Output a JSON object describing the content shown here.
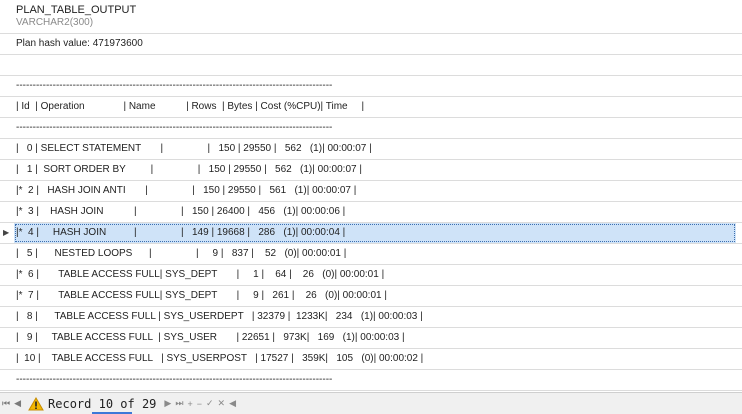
{
  "column": {
    "name": "PLAN_TABLE_OUTPUT",
    "type": "VARCHAR2(300)"
  },
  "rows": [
    "Plan hash value: 471973600",
    "",
    "-----------------------------------------------------------------------------------------------",
    "| Id  | Operation              | Name           | Rows  | Bytes | Cost (%CPU)| Time     |",
    "-----------------------------------------------------------------------------------------------",
    "|   0 | SELECT STATEMENT       |                |   150 | 29550 |   562   (1)| 00:00:07 |",
    "|   1 |  SORT ORDER BY         |                |   150 | 29550 |   562   (1)| 00:00:07 |",
    "|*  2 |   HASH JOIN ANTI       |                |   150 | 29550 |   561   (1)| 00:00:07 |",
    "|*  3 |    HASH JOIN           |                |   150 | 26400 |   456   (1)| 00:00:06 |",
    "|*  4 |     HASH JOIN          |                |   149 | 19668 |   286   (1)| 00:00:04 |",
    "|   5 |      NESTED LOOPS      |                |     9 |   837 |    52   (0)| 00:00:01 |",
    "|*  6 |       TABLE ACCESS FULL| SYS_DEPT       |     1 |    64 |    26   (0)| 00:00:01 |",
    "|*  7 |       TABLE ACCESS FULL| SYS_DEPT       |     9 |   261 |    26   (0)| 00:00:01 |",
    "|   8 |      TABLE ACCESS FULL | SYS_USERDEPT   | 32379 |  1233K|   234   (1)| 00:00:03 |",
    "|   9 |     TABLE ACCESS FULL  | SYS_USER       | 22651 |   973K|   169   (1)| 00:00:03 |",
    "|  10 |    TABLE ACCESS FULL   | SYS_USERPOST   | 17527 |   359K|   105   (0)| 00:00:02 |",
    "-----------------------------------------------------------------------------------------------",
    ""
  ],
  "selected_row_index": 9,
  "statusbar": {
    "record_text": "Record 10 of 29",
    "nav_first": "⏮",
    "nav_prev": "◀",
    "nav_next": "▶",
    "nav_last": "⏭",
    "add": "+",
    "remove": "−",
    "confirm": "✓",
    "cancel": "✕",
    "more": "◀",
    "icon": "warning-icon"
  }
}
